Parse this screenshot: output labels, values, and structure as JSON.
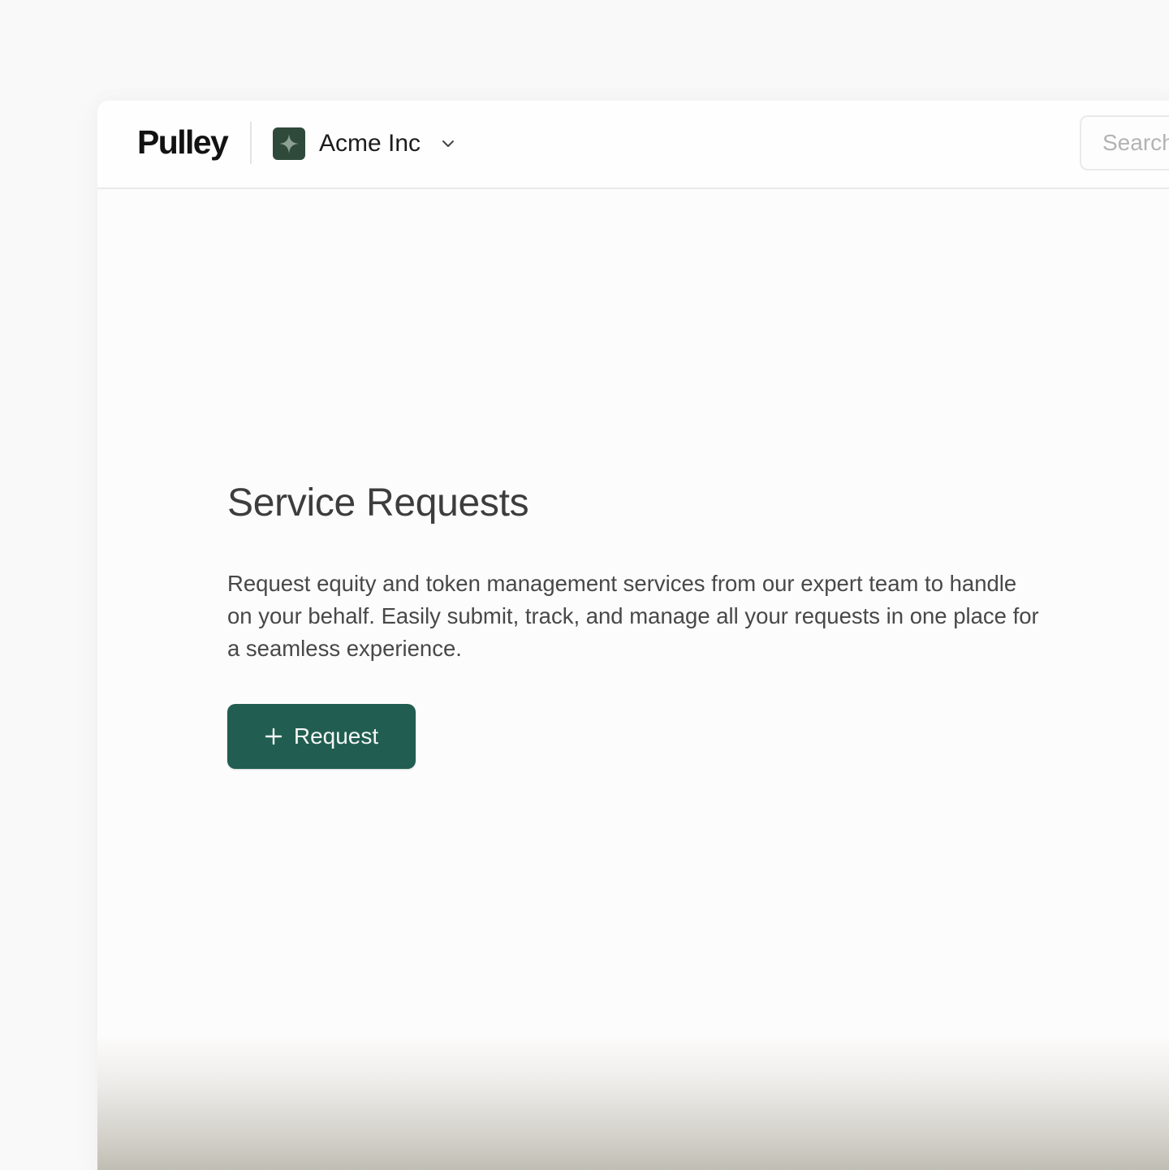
{
  "header": {
    "logo_text": "Pulley",
    "company": {
      "name": "Acme Inc",
      "badge_icon": "sparkle-icon",
      "badge_color": "#2f4a3a"
    },
    "search": {
      "placeholder": "Search"
    }
  },
  "main": {
    "title": "Service Requests",
    "description": "Request equity and token management services from our expert team to handle on your behalf. Easily submit, track, and manage all your requests in one place for a seamless experience.",
    "request_button": {
      "label": "Request",
      "icon": "plus-icon",
      "color": "#215e51"
    }
  }
}
